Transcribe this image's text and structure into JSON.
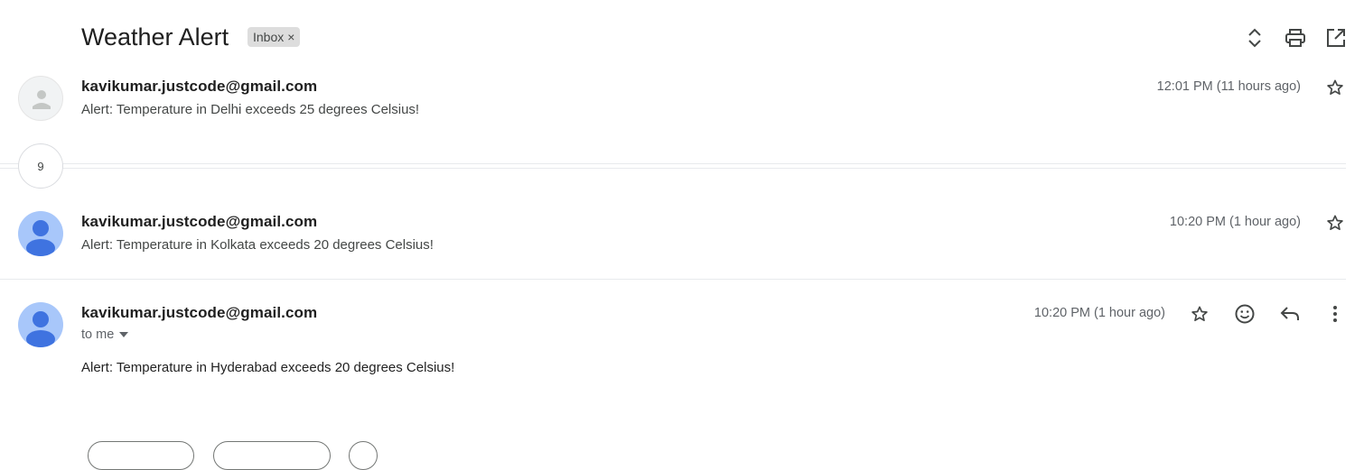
{
  "thread": {
    "subject": "Weather Alert",
    "label": "Inbox",
    "label_remove": "×",
    "message_count": "9"
  },
  "messages": [
    {
      "sender": "kavikumar.justcode@gmail.com",
      "snippet": "Alert: Temperature in Delhi exceeds 25 degrees Celsius!",
      "time": "12:01 PM (11 hours ago)"
    },
    {
      "sender": "kavikumar.justcode@gmail.com",
      "snippet": "Alert: Temperature in Kolkata exceeds 20 degrees Celsius!",
      "time": "10:20 PM (1 hour ago)"
    },
    {
      "sender": "kavikumar.justcode@gmail.com",
      "recipient": "to me",
      "body": "Alert: Temperature in Hyderabad exceeds 20 degrees Celsius!",
      "time": "10:20 PM (1 hour ago)"
    }
  ],
  "icons": {
    "expand": "unfold-icon",
    "print": "print-icon",
    "open_new": "open-in-new-window-icon",
    "star": "star-icon",
    "emoji": "emoji-icon",
    "reply": "reply-icon",
    "more": "more-vert-icon",
    "dropdown": "caret-down-icon"
  },
  "colors": {
    "avatar_blue": "#a8c7fa",
    "avatar_blue_figure": "#3f73e0",
    "avatar_gray_figure": "#c4c7c5"
  }
}
